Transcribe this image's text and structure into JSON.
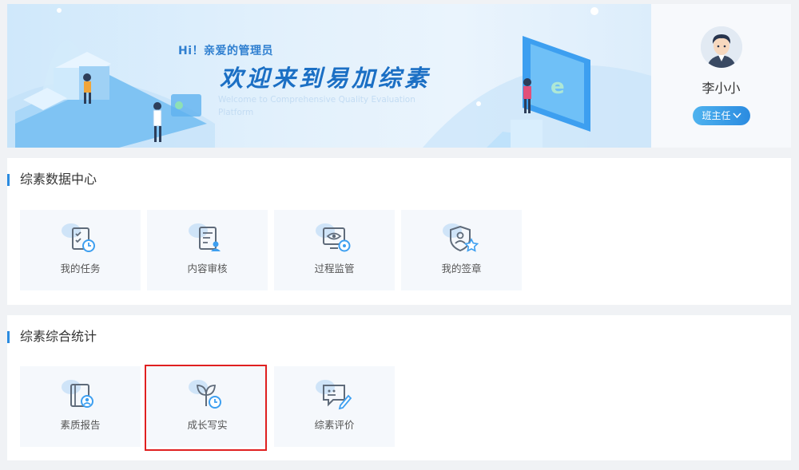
{
  "banner": {
    "greeting": "Hi！亲爱的管理员",
    "welcome": "欢迎来到易加综素",
    "welcome_en": "Welcome to Comprehensive Quality Evaluation Platform"
  },
  "user": {
    "name": "李小小",
    "role": "班主任",
    "role_icon": "chevron-down-icon"
  },
  "sections": [
    {
      "title": "综素数据中心",
      "items": [
        {
          "label": "我的任务",
          "icon": "task-checklist-icon"
        },
        {
          "label": "内容审核",
          "icon": "content-review-icon"
        },
        {
          "label": "过程监管",
          "icon": "process-monitor-icon"
        },
        {
          "label": "我的签章",
          "icon": "signature-shield-icon"
        }
      ]
    },
    {
      "title": "综素综合统计",
      "items": [
        {
          "label": "素质报告",
          "icon": "quality-report-icon"
        },
        {
          "label": "成长写实",
          "icon": "growth-record-icon"
        },
        {
          "label": "综素评价",
          "icon": "evaluation-icon"
        }
      ]
    }
  ],
  "colors": {
    "accent": "#2b8be0",
    "highlight": "#e02020",
    "card_bg": "#f5f8fc"
  }
}
